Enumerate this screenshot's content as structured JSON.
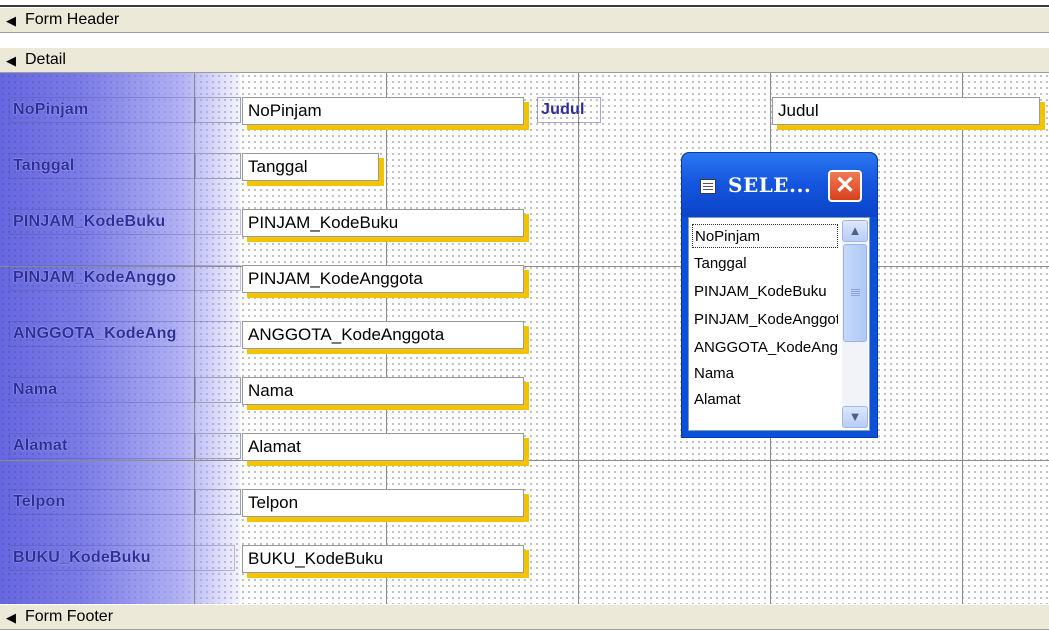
{
  "sections": {
    "form_header": "Form Header",
    "detail": "Detail",
    "form_footer": "Form Footer",
    "arrow_icon": "section-collapse-arrow-icon"
  },
  "labels": {
    "nopinjam": "NoPinjam",
    "tanggal": "Tanggal",
    "pinjam_kodebuku": "PINJAM_KodeBuku",
    "pinjam_kodeanggota": "PINJAM_KodeAnggo",
    "anggota_kodeanggota": "ANGGOTA_KodeAng",
    "nama": "Nama",
    "alamat": "Alamat",
    "telpon": "Telpon",
    "buku_kodebuku": "BUKU_KodeBuku",
    "judul": "Judul"
  },
  "textboxes": {
    "nopinjam": "NoPinjam",
    "tanggal": "Tanggal",
    "pinjam_kodebuku": "PINJAM_KodeBuku",
    "pinjam_kodeanggota": "PINJAM_KodeAnggota",
    "anggota_kodeanggota": "ANGGOTA_KodeAnggota",
    "nama": "Nama",
    "alamat": "Alamat",
    "telpon": "Telpon",
    "buku_kodebuku": "BUKU_KodeBuku",
    "judul": "Judul"
  },
  "field_list": {
    "title": "SELE...",
    "close": "✕",
    "items": [
      "NoPinjam",
      "Tanggal",
      "PINJAM_KodeBuku",
      "PINJAM_KodeAnggota",
      "ANGGOTA_KodeAnggota",
      "Nama",
      "Alamat"
    ],
    "scroll_up": "▲",
    "scroll_down": "▼"
  },
  "colors": {
    "label_text": "#2c2c9a",
    "textbox_shadow": "#f3c300",
    "titlebar": "#0a50d8"
  }
}
